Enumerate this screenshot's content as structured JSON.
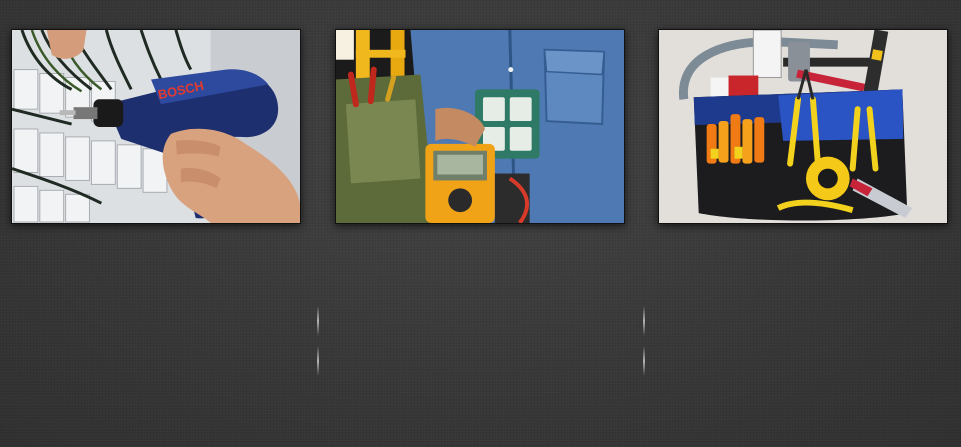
{
  "gallery": {
    "items": [
      {
        "icon": "power-drill-photo",
        "brand_text": "BOSCH"
      },
      {
        "icon": "multimeter-photo"
      },
      {
        "icon": "tool-bag-photo"
      }
    ]
  },
  "colors": {
    "background": "#3a3a3a",
    "frame_border": "#111111",
    "divider": "#dcdcdc"
  }
}
